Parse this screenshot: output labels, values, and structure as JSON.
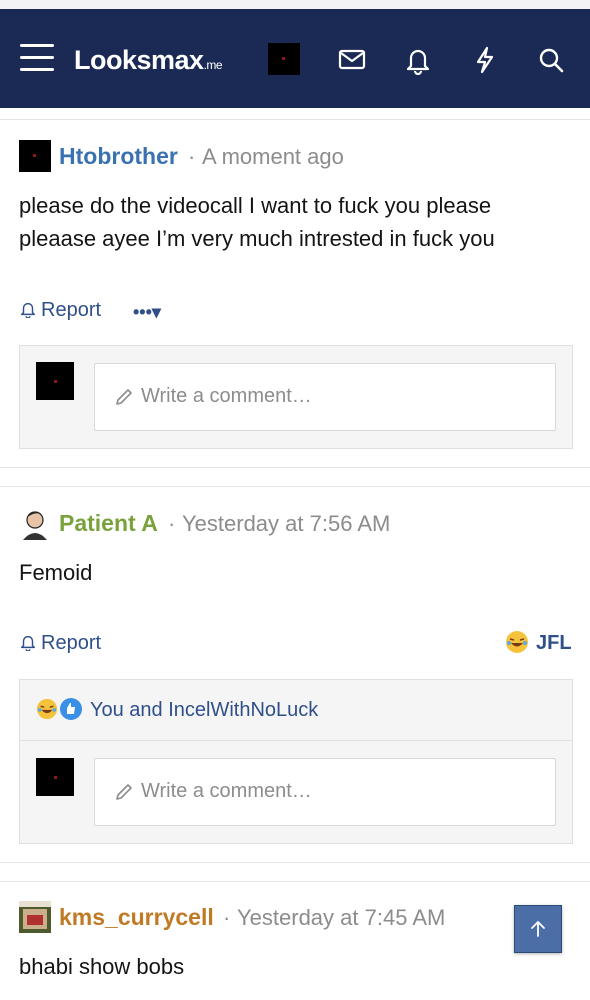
{
  "header": {
    "logo": "Looksmax",
    "logo_suffix": ".me",
    "icons": [
      "menu-icon",
      "inbox-icon",
      "bell-icon",
      "lightning-icon",
      "search-icon"
    ],
    "bg_color": "#1b2a55"
  },
  "posts": [
    {
      "author": "Htobrother",
      "author_color": "#3a72b0",
      "time": "A moment ago",
      "body_lines": [
        "please do the videocall I want to fuck you please",
        "pleaase ayee I’m very much intrested in fuck you"
      ],
      "report": "Report",
      "more": "•••▾",
      "comment_placeholder": "Write a comment…"
    },
    {
      "author": "Patient A",
      "author_color": "#7aa23c",
      "time": "Yesterday at 7:56 AM",
      "body": "Femoid",
      "report": "Report",
      "reaction_label": "JFL",
      "reactions_text": "You and IncelWithNoLuck",
      "comment_placeholder": "Write a comment…"
    },
    {
      "author": "kms_currycell",
      "author_color": "#c07a24",
      "time": "Yesterday at 7:45 AM",
      "body": "bhabi show bobs"
    }
  ],
  "meta_sep": "·"
}
